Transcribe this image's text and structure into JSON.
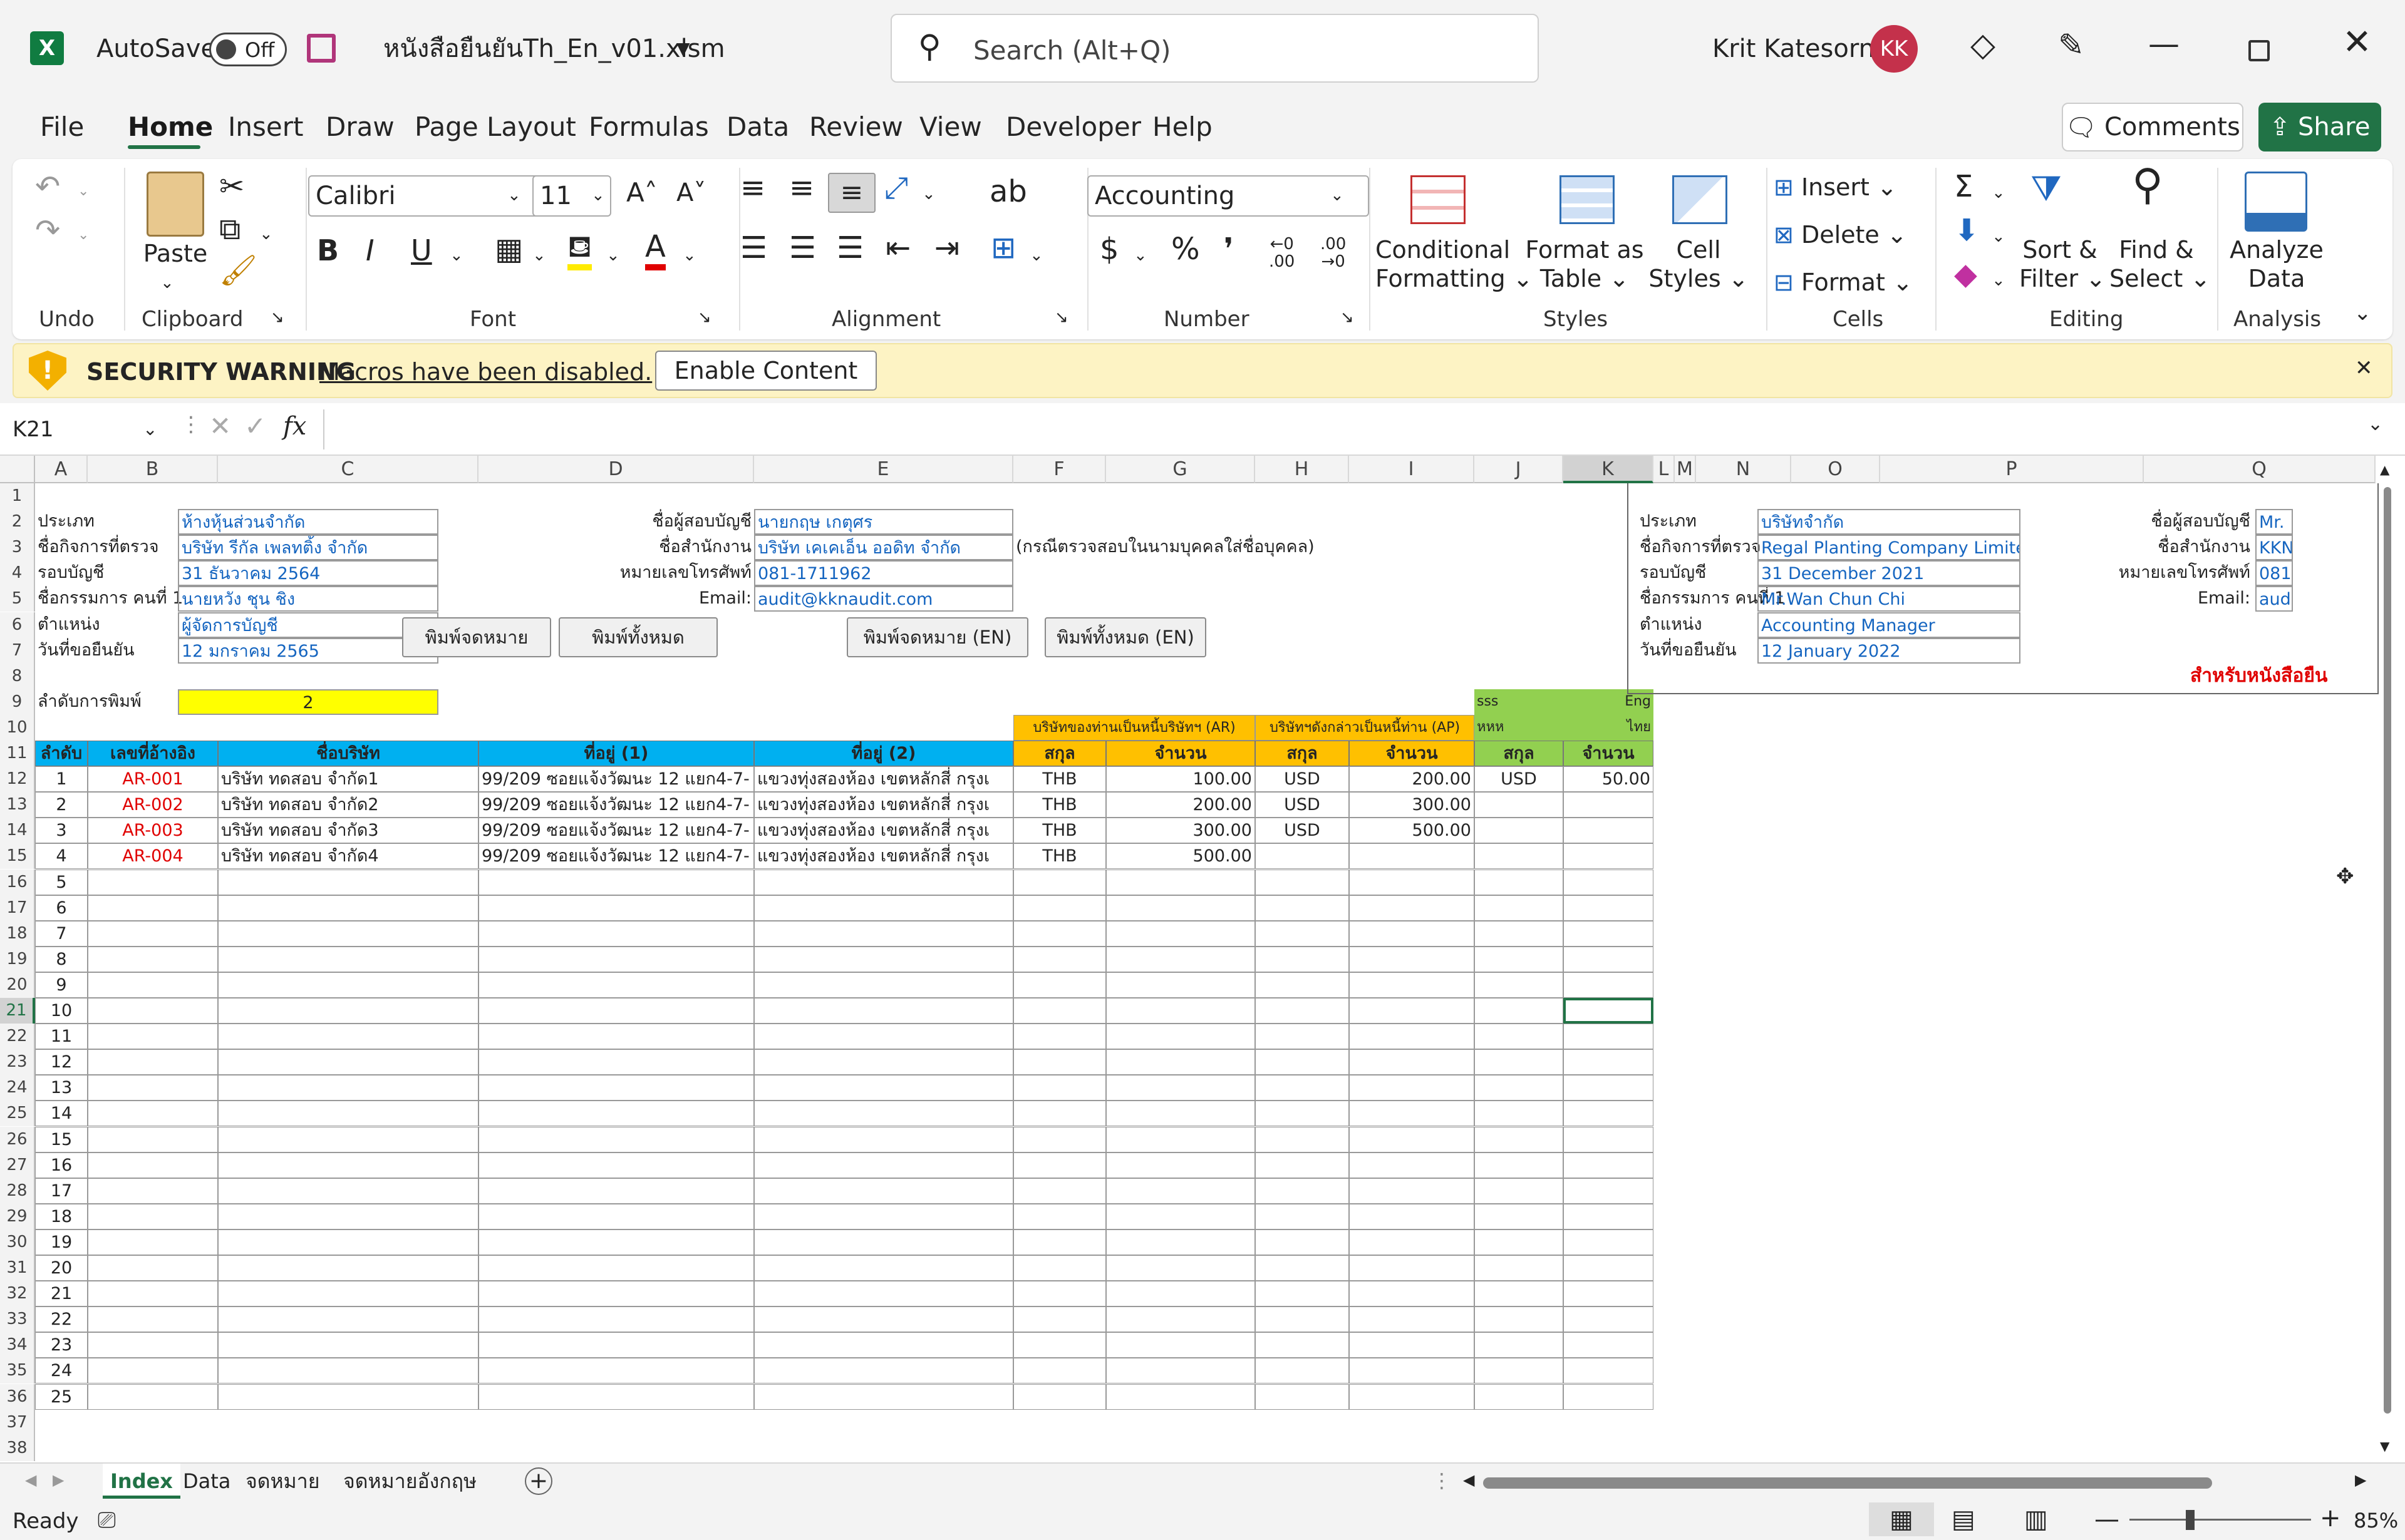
{
  "titlebar": {
    "autosave_label": "AutoSave",
    "autosave_state": "Off",
    "filename": "หนังสือยืนยันTh_En_v01.xlsm",
    "search_placeholder": "Search (Alt+Q)",
    "user_name": "Krit Katesorn",
    "user_initials": "KK"
  },
  "menu": {
    "items": [
      "File",
      "Home",
      "Insert",
      "Draw",
      "Page Layout",
      "Formulas",
      "Data",
      "Review",
      "View",
      "Developer",
      "Help"
    ],
    "comments_label": "Comments",
    "share_label": "Share"
  },
  "ribbon": {
    "groups": {
      "undo": "Undo",
      "clipboard": "Clipboard",
      "font": "Font",
      "alignment": "Alignment",
      "number": "Number",
      "styles": "Styles",
      "cells": "Cells",
      "editing": "Editing",
      "analysis": "Analysis"
    },
    "paste_label": "Paste",
    "font_name": "Calibri",
    "font_size": "11",
    "number_format": "Accounting",
    "conditional_formatting": [
      "Conditional",
      "Formatting"
    ],
    "format_as_table": [
      "Format as",
      "Table"
    ],
    "cell_styles": [
      "Cell",
      "Styles"
    ],
    "cells_insert": "Insert",
    "cells_delete": "Delete",
    "cells_format": "Format",
    "sort_filter": [
      "Sort &",
      "Filter"
    ],
    "find_select": [
      "Find &",
      "Select"
    ],
    "analyze_data": [
      "Analyze",
      "Data"
    ]
  },
  "security": {
    "title": "SECURITY WARNING",
    "message": "Macros have been disabled.",
    "button": "Enable Content"
  },
  "formula_bar": {
    "name_box": "K21",
    "fx": "fx",
    "content": ""
  },
  "columns": [
    "A",
    "B",
    "C",
    "D",
    "E",
    "F",
    "G",
    "H",
    "I",
    "J",
    "K",
    "L",
    "M",
    "N",
    "O",
    "P",
    "Q"
  ],
  "sheet": {
    "labels_left": [
      "ประเภท",
      "ชื่อกิจการที่ตรวจ",
      "รอบบัญชี",
      "ชื่อกรรมการ คนที่ 1",
      "ตำแหน่ง",
      "วันที่ขอยืนยัน"
    ],
    "values_left": [
      "ห้างหุ้นส่วนจำกัด",
      "บริษัท รีกัล เพลทติ้ง จำกัด",
      "31 ธันวาคม 2564",
      "นายหวัง ชุน ชิง",
      "ผู้จัดการบัญชี",
      "12 มกราคม 2565"
    ],
    "labels_mid": [
      "ชื่อผู้สอบบัญชี",
      "ชื่อสำนักงาน",
      "หมายเลขโทรศัพท์",
      "Email:"
    ],
    "values_mid": [
      "นายกฤษ  เกตุศร",
      "บริษัท เคเคเอ็น ออดิท จำกัด",
      "081-1711962",
      "audit@kknaudit.com"
    ],
    "note_mid": "(กรณีตรวจสอบในนามบุคคลใส่ชื่อบุคคล)",
    "print_buttons": [
      "พิมพ์จดหมาย",
      "พิมพ์ทั้งหมด",
      "พิมพ์จดหมาย (EN)",
      "พิมพ์ทั้งหมด (EN)"
    ],
    "print_order_label": "ลำดับการพิมพ์",
    "print_order_value": "2",
    "hdr_sss": "sss",
    "hdr_eng": "Eng",
    "hdr_hhh": "หหห",
    "hdr_thai": "ไทย",
    "hdr_ar": "บริษัทของท่านเป็นหนี้บริษัทฯ (AR)",
    "hdr_ap": "บริษัทฯดังกล่าวเป็นหนี้ท่าน (AP)",
    "table_headers": [
      "ลำดับ",
      "เลขที่อ้างอิง",
      "ชื่อบริษัท",
      "ที่อยู่ (1)",
      "ที่อยู่ (2)",
      "สกุล",
      "จำนวน",
      "สกุล",
      "จำนวน",
      "สกุล",
      "จำนวน"
    ],
    "rows": [
      {
        "no": "1",
        "ref": "AR-001",
        "name": "บริษัท ทดสอบ จำกัด1",
        "addr1": "99/209 ซอยแจ้งวัฒนะ 12 แยก4-7-",
        "addr2": "แขวงทุ่งสองห้อง เขตหลักสี่ กรุงเ",
        "cur1": "THB",
        "amt1": "100.00",
        "cur2": "USD",
        "amt2": "200.00",
        "cur3": "USD",
        "amt3": "50.00"
      },
      {
        "no": "2",
        "ref": "AR-002",
        "name": "บริษัท ทดสอบ จำกัด2",
        "addr1": "99/209 ซอยแจ้งวัฒนะ 12 แยก4-7-",
        "addr2": "แขวงทุ่งสองห้อง เขตหลักสี่ กรุงเ",
        "cur1": "THB",
        "amt1": "200.00",
        "cur2": "USD",
        "amt2": "300.00",
        "cur3": "",
        "amt3": ""
      },
      {
        "no": "3",
        "ref": "AR-003",
        "name": "บริษัท ทดสอบ จำกัด3",
        "addr1": "99/209 ซอยแจ้งวัฒนะ 12 แยก4-7-",
        "addr2": "แขวงทุ่งสองห้อง เขตหลักสี่ กรุงเ",
        "cur1": "THB",
        "amt1": "300.00",
        "cur2": "USD",
        "amt2": "500.00",
        "cur3": "",
        "amt3": ""
      },
      {
        "no": "4",
        "ref": "AR-004",
        "name": "บริษัท ทดสอบ จำกัด4",
        "addr1": "99/209 ซอยแจ้งวัฒนะ 12 แยก4-7-",
        "addr2": "แขวงทุ่งสองห้อง เขตหลักสี่ กรุงเ",
        "cur1": "THB",
        "amt1": "500.00",
        "cur2": "",
        "amt2": "",
        "cur3": "",
        "amt3": ""
      }
    ],
    "seq_numbers": [
      "5",
      "6",
      "7",
      "8",
      "9",
      "10",
      "11",
      "12",
      "13",
      "14",
      "15",
      "16",
      "17",
      "18",
      "19",
      "20",
      "21",
      "22",
      "23",
      "24",
      "25"
    ],
    "labels_right": [
      "ประเภท",
      "ชื่อกิจการที่ตรวจ",
      "รอบบัญชี",
      "ชื่อกรรมการ คนที่ 1",
      "ตำแหน่ง",
      "วันที่ขอยืนยัน"
    ],
    "values_right": [
      "บริษัทจำกัด",
      "Regal Planting Company Limited",
      "31 December 2021",
      "Mr.Wan Chun Chi",
      "Accounting Manager",
      "12 January 2022"
    ],
    "labels_right2": [
      "ชื่อผู้สอบบัญชี",
      "ชื่อสำนักงาน",
      "หมายเลขโทรศัพท์",
      "Email:"
    ],
    "values_right2": [
      "Mr.",
      "KKN",
      "081",
      "aud"
    ],
    "right_red_note": "สำหรับหนังสือยืน"
  },
  "sheet_tabs": [
    "Index",
    "Data",
    "จดหมาย",
    "จดหมายอังกฤษ"
  ],
  "status": {
    "ready": "Ready",
    "zoom": "85%"
  },
  "colors": {
    "accent": "#217346",
    "blue_header": "#00b0f0",
    "orange_header": "#ffc000",
    "green_header": "#92d050",
    "yellow_cell": "#ffff00"
  }
}
